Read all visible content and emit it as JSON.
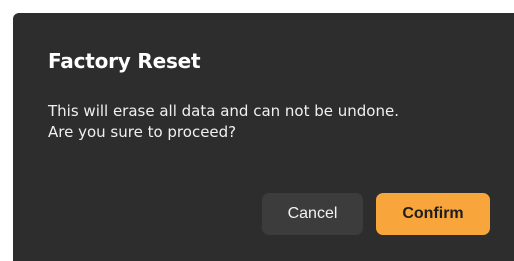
{
  "dialog": {
    "title": "Factory Reset",
    "message_lines": [
      "This will erase all data and can not be undone.",
      "Are you sure to proceed?"
    ],
    "cancel_label": "Cancel",
    "confirm_label": "Confirm"
  },
  "colors": {
    "dialog_background": "#2d2d2d",
    "cancel_button": "#3c3c3c",
    "confirm_button": "#f8a53c",
    "text": "#ffffff"
  }
}
